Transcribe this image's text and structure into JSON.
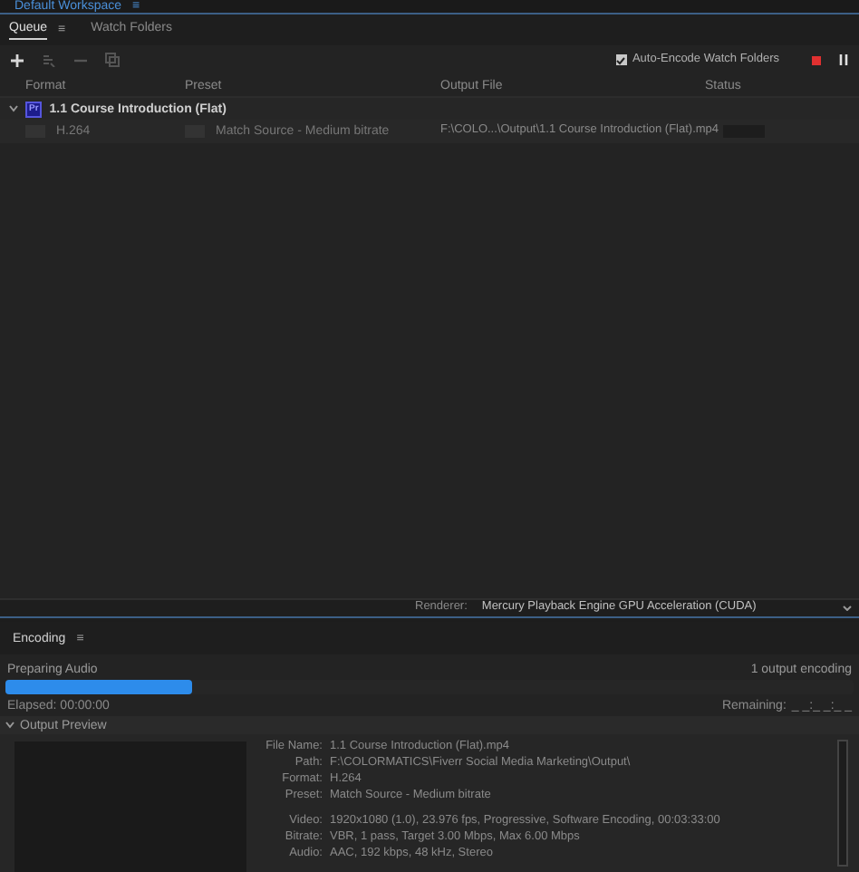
{
  "workspace_tab": {
    "label": "Default Workspace",
    "menu": "≡"
  },
  "queue_panel": {
    "tabs": [
      {
        "label": "Queue",
        "selected": true,
        "menu": "≡"
      },
      {
        "label": "Watch Folders",
        "selected": false
      }
    ],
    "auto_encode": {
      "label": "Auto-Encode Watch Folders",
      "checked": true
    },
    "columns": [
      "Format",
      "Preset",
      "Output File",
      "Status"
    ],
    "groups": [
      {
        "title": "1.1 Course Introduction (Flat)",
        "expanded": true,
        "app_badge": "Pr",
        "items": [
          {
            "format": "H.264",
            "preset": "Match Source - Medium bitrate",
            "output_file": "F:\\COLO...\\Output\\1.1 Course Introduction (Flat).mp4"
          }
        ]
      }
    ],
    "renderer": {
      "label": "Renderer:",
      "value": "Mercury Playback Engine GPU Acceleration (CUDA)"
    }
  },
  "encoding_panel": {
    "title": "Encoding",
    "menu": "≡",
    "status": "Preparing Audio",
    "count": "1 output encoding",
    "level": 0.22,
    "elapsed": "Elapsed: 00:00:00",
    "remaining_label": "Remaining:",
    "remaining": "_ _:_ _:_ _",
    "output_preview": {
      "title": "Output Preview",
      "expanded": true,
      "detail_groups": [
        [
          {
            "label": "File Name:",
            "value": "1.1 Course Introduction (Flat).mp4"
          },
          {
            "label": "Path:",
            "value": "F:\\COLORMATICS\\Fiverr Social Media Marketing\\Output\\"
          },
          {
            "label": "Format:",
            "value": "H.264"
          },
          {
            "label": "Preset:",
            "value": "Match Source - Medium bitrate"
          }
        ],
        [
          {
            "label": "Video:",
            "value": "1920x1080 (1.0), 23.976 fps, Progressive, Software Encoding, 00:03:33:00"
          },
          {
            "label": "Bitrate:",
            "value": "VBR, 1 pass, Target 3.00 Mbps, Max 6.00 Mbps"
          },
          {
            "label": "Audio:",
            "value": "AAC, 192 kbps, 48 kHz, Stereo"
          }
        ]
      ]
    }
  }
}
